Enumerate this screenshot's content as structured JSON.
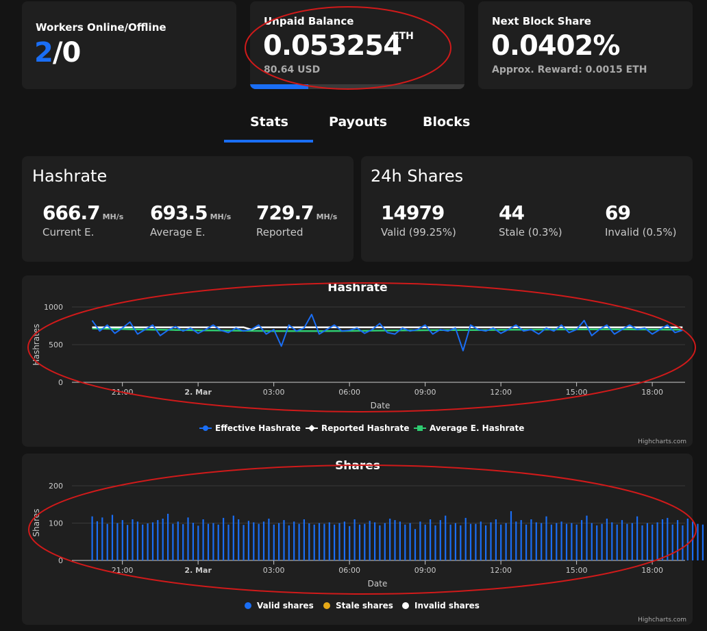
{
  "workers": {
    "label": "Workers Online/Offline",
    "online": "2",
    "separator": "/",
    "offline": "0"
  },
  "balance": {
    "label": "Unpaid Balance",
    "value": "0.053254",
    "unit": "ETH",
    "usd": "80.64 USD",
    "progress": 0.27
  },
  "block_share": {
    "label": "Next Block Share",
    "value": "0.0402%",
    "reward": "Approx. Reward: 0.0015 ETH"
  },
  "tabs": [
    {
      "label": "Stats",
      "active": true
    },
    {
      "label": "Payouts"
    },
    {
      "label": "Blocks"
    }
  ],
  "hashrate_card": {
    "title": "Hashrate",
    "stats": [
      {
        "value": "666.7",
        "unit": "MH/s",
        "caption": "Current E."
      },
      {
        "value": "693.5",
        "unit": "MH/s",
        "caption": "Average E."
      },
      {
        "value": "729.7",
        "unit": "MH/s",
        "caption": "Reported"
      }
    ]
  },
  "shares_card": {
    "title": "24h Shares",
    "stats": [
      {
        "value": "14979",
        "caption": "Valid (99.25%)"
      },
      {
        "value": "44",
        "caption": "Stale (0.3%)"
      },
      {
        "value": "69",
        "caption": "Invalid (0.5%)"
      }
    ]
  },
  "colors": {
    "accent": "#1a6ef5",
    "green": "#2ecc71",
    "annotation": "#d11a1a",
    "stale": "#e6a817"
  },
  "credits": "Highcharts.com",
  "chart_data": [
    {
      "type": "line",
      "title": "Hashrate",
      "xlabel": "Date",
      "ylabel": "Hashrates",
      "ylim": [
        0,
        1000
      ],
      "yticks": [
        "0",
        "500",
        "1000"
      ],
      "xticks": [
        "21:00",
        "2. Mar",
        "03:00",
        "06:00",
        "09:00",
        "12:00",
        "15:00",
        "18:00"
      ],
      "x_hours": [
        19.8,
        20.1,
        20.4,
        20.7,
        21.0,
        21.3,
        21.6,
        21.9,
        22.2,
        22.5,
        22.8,
        23.1,
        23.4,
        23.7,
        24.0,
        24.3,
        24.6,
        24.9,
        25.2,
        25.5,
        25.8,
        26.1,
        26.4,
        26.7,
        27.0,
        27.3,
        27.6,
        27.9,
        28.2,
        28.5,
        28.8,
        29.1,
        29.4,
        29.7,
        30.0,
        30.3,
        30.6,
        30.9,
        31.2,
        31.5,
        31.8,
        32.1,
        32.4,
        32.7,
        33.0,
        33.3,
        33.6,
        33.9,
        34.2,
        34.5,
        34.8,
        35.1,
        35.4,
        35.7,
        36.0,
        36.3,
        36.6,
        36.9,
        37.2,
        37.5,
        37.8,
        38.1,
        38.4,
        38.7,
        39.0,
        39.3,
        39.6,
        39.9,
        40.2,
        40.5,
        40.8,
        41.1,
        41.4,
        41.7,
        42.0,
        42.3,
        42.6,
        42.9,
        43.2
      ],
      "series": [
        {
          "name": "Effective Hashrate",
          "color": "#1a6ef5",
          "values": [
            820,
            680,
            760,
            650,
            720,
            800,
            640,
            700,
            760,
            620,
            690,
            740,
            680,
            720,
            650,
            700,
            760,
            690,
            660,
            720,
            680,
            700,
            760,
            640,
            700,
            480,
            760,
            680,
            720,
            900,
            640,
            700,
            760,
            680,
            690,
            720,
            650,
            700,
            780,
            660,
            640,
            720,
            680,
            700,
            760,
            640,
            700,
            680,
            720,
            420,
            760,
            700,
            680,
            720,
            650,
            700,
            760,
            680,
            700,
            640,
            720,
            680,
            760,
            660,
            700,
            820,
            620,
            700,
            760,
            640,
            700,
            760,
            700,
            720,
            640,
            700,
            760,
            660,
            690
          ]
        },
        {
          "name": "Reported Hashrate",
          "color": "#ffffff",
          "values": [
            730,
            730,
            730,
            730,
            730,
            730,
            730,
            730,
            730,
            730,
            730,
            730,
            730,
            730,
            730,
            730,
            730,
            730,
            730,
            730,
            730,
            700,
            730,
            730,
            730,
            730,
            730,
            730,
            730,
            730,
            730,
            730,
            730,
            730,
            730,
            730,
            730,
            730,
            730,
            730,
            730,
            730,
            730,
            730,
            730,
            730,
            730,
            730,
            730,
            730,
            730,
            730,
            730,
            730,
            730,
            730,
            730,
            730,
            730,
            730,
            730,
            730,
            730,
            730,
            730,
            730,
            730,
            730,
            730,
            730,
            730,
            730,
            730,
            730,
            730,
            730,
            730,
            730,
            730
          ]
        },
        {
          "name": "Average E. Hashrate",
          "color": "#2ecc71",
          "values": [
            715,
            712,
            710,
            708,
            706,
            704,
            702,
            700,
            698,
            697,
            696,
            694,
            693,
            692,
            690,
            689,
            688,
            687,
            686,
            685,
            684,
            683,
            682,
            681,
            680,
            680,
            680,
            679,
            679,
            679,
            680,
            680,
            681,
            681,
            682,
            683,
            684,
            685,
            686,
            687,
            688,
            689,
            690,
            690,
            691,
            692,
            693,
            693,
            694,
            694,
            693,
            693,
            694,
            695,
            696,
            697,
            698,
            698,
            699,
            700,
            700,
            701,
            701,
            702,
            702,
            703,
            703,
            703,
            703,
            702,
            702,
            702,
            701,
            701,
            700,
            700,
            699,
            699,
            699
          ]
        }
      ],
      "legend": "bottom-center"
    },
    {
      "type": "bar",
      "title": "Shares",
      "xlabel": "Date",
      "ylabel": "Shares",
      "ylim": [
        0,
        200
      ],
      "yticks": [
        "0",
        "100",
        "200"
      ],
      "xticks": [
        "21:00",
        "2. Mar",
        "03:00",
        "06:00",
        "09:00",
        "12:00",
        "15:00",
        "18:00"
      ],
      "x_start_hours": 19.8,
      "x_step_hours": 0.2,
      "series": [
        {
          "name": "Valid shares",
          "color": "#1a6ef5",
          "values": [
            118,
            105,
            115,
            98,
            122,
            100,
            108,
            95,
            110,
            104,
            96,
            99,
            102,
            108,
            112,
            125,
            98,
            104,
            97,
            115,
            101,
            93,
            110,
            98,
            100,
            96,
            114,
            96,
            120,
            110,
            95,
            106,
            102,
            98,
            104,
            112,
            96,
            100,
            108,
            94,
            104,
            98,
            110,
            99,
            96,
            100,
            98,
            102,
            96,
            100,
            104,
            92,
            110,
            96,
            98,
            106,
            102,
            94,
            100,
            112,
            108,
            104,
            96,
            100,
            84,
            104,
            96,
            110,
            94,
            108,
            120,
            96,
            100,
            94,
            114,
            98,
            98,
            104,
            94,
            102,
            110,
            96,
            100,
            132,
            104,
            108,
            96,
            110,
            102,
            100,
            118,
            96,
            100,
            104,
            98,
            100,
            96,
            108,
            120,
            100,
            94,
            98,
            112,
            102,
            96,
            108,
            98,
            100,
            118,
            94,
            100,
            96,
            102,
            110,
            114,
            96,
            108,
            94,
            112,
            104,
            98,
            96,
            104,
            114,
            94,
            100,
            104,
            108,
            96,
            112,
            94,
            120,
            110,
            98,
            104,
            96,
            100,
            112,
            104,
            94,
            96,
            106,
            98,
            112,
            100,
            96,
            102,
            94,
            104,
            98,
            116,
            100,
            94,
            98,
            124,
            112,
            94,
            100,
            110,
            102,
            96,
            108,
            96,
            102,
            118,
            96,
            100,
            94,
            104,
            100,
            96
          ]
        },
        {
          "name": "Stale shares",
          "color": "#e6a817",
          "values": []
        },
        {
          "name": "Invalid shares",
          "color": "#ffffff",
          "values": []
        }
      ],
      "legend": "bottom-center"
    }
  ]
}
